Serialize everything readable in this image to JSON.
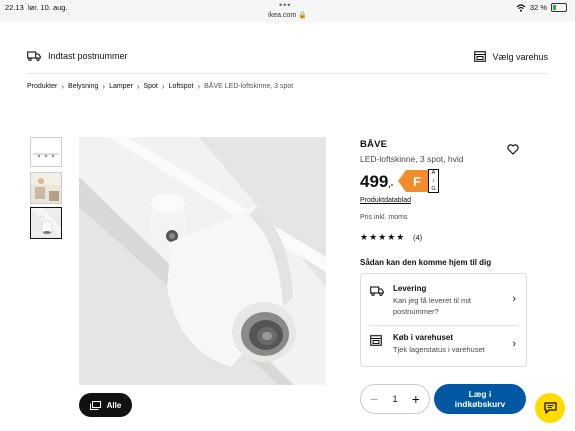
{
  "status_bar": {
    "time": "22.13",
    "date": "lør. 10. aug.",
    "url": "ikea.com",
    "battery": "32 %",
    "dots": "•••"
  },
  "topbar": {
    "postcode_label": "Indtast postnummer",
    "store_label": "Vælg varehus"
  },
  "breadcrumb": [
    "Produkter",
    "Belysning",
    "Lamper",
    "Spot",
    "Loftspot",
    "BÅVE LED-loftskinne, 3 spot"
  ],
  "breadcrumb_separator": "›",
  "gallery": {
    "all_label": "Alle"
  },
  "product": {
    "name": "BÅVE",
    "description": "LED-loftskinne, 3 spot, hvid",
    "price": "499",
    "price_suffix": ",-",
    "energy_class": "F",
    "energy_scale_top": "A",
    "energy_scale_bottom": "G",
    "datasheet_link": "Produktdatablad",
    "vat_note": "Pris inkl. moms",
    "rating": 5,
    "stars": "★★★★★",
    "review_count": "(4)"
  },
  "delivery": {
    "title": "Sådan kan den komme hjem til dig",
    "options": [
      {
        "title": "Levering",
        "desc": "Kan jeg få leveret til mit postnummer?"
      },
      {
        "title": "Køb i varehuset",
        "desc": "Tjek lagerstatus i varehuset"
      }
    ]
  },
  "cart": {
    "quantity": "1",
    "minus": "−",
    "plus": "+",
    "line1": "Læg i",
    "line2": "indkøbskurv"
  },
  "colors": {
    "accent": "#0058a3",
    "energy": "#f28c2b",
    "chat": "#ffdb00"
  },
  "icons": [
    "truck-icon",
    "store-icon",
    "heart-icon",
    "chevron-right-icon",
    "gallery-icon",
    "chat-icon"
  ]
}
